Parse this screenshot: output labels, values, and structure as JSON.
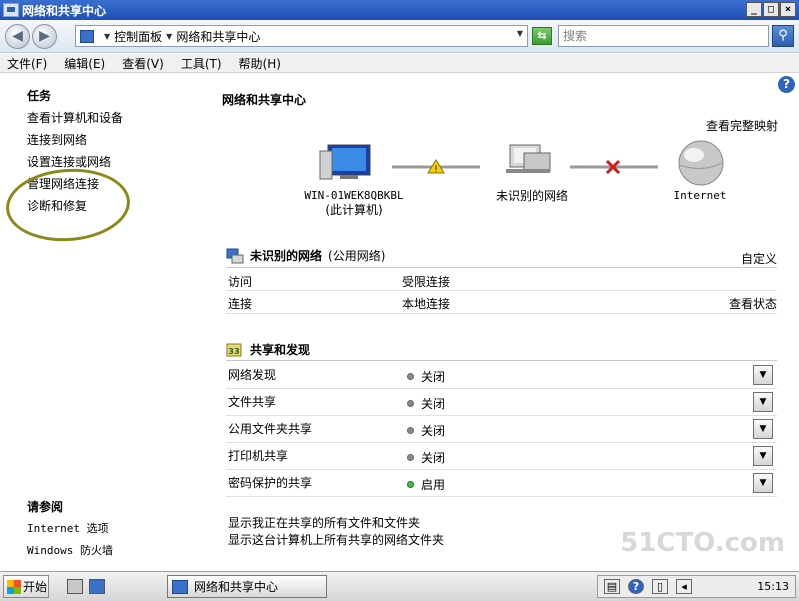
{
  "window": {
    "title": "网络和共享中心"
  },
  "win_buttons": {
    "minimize": "_",
    "maximize": "□",
    "close": "×"
  },
  "address": {
    "crumbs": [
      "控制面板",
      "网络和共享中心"
    ],
    "search_placeholder": "搜索"
  },
  "menu": [
    "文件(F)",
    "编辑(E)",
    "查看(V)",
    "工具(T)",
    "帮助(H)"
  ],
  "tasks": {
    "heading": "任务",
    "links": [
      "查看计算机和设备",
      "连接到网络",
      "设置连接或网络",
      "管理网络连接",
      "诊断和修复"
    ]
  },
  "see_also": {
    "heading": "请参阅",
    "links": [
      "Internet 选项",
      "Windows 防火墙"
    ]
  },
  "main": {
    "title": "网络和共享中心",
    "view_full_map": "查看完整映射",
    "diagram": {
      "computer_name": "WIN-01WEK8QBKBL",
      "computer_sub": "(此计算机)",
      "network_name": "未识别的网络",
      "internet": "Internet"
    },
    "network": {
      "name": "未识别的网络",
      "type": "(公用网络)",
      "customize": "自定义",
      "rows": [
        {
          "label": "访问",
          "value": "受限连接",
          "action": ""
        },
        {
          "label": "连接",
          "value": "本地连接",
          "action": "查看状态"
        }
      ]
    },
    "sharing": {
      "title": "共享和发现",
      "rows": [
        {
          "label": "网络发现",
          "value": "关闭",
          "on": false
        },
        {
          "label": "文件共享",
          "value": "关闭",
          "on": false
        },
        {
          "label": "公用文件夹共享",
          "value": "关闭",
          "on": false
        },
        {
          "label": "打印机共享",
          "value": "关闭",
          "on": false
        },
        {
          "label": "密码保护的共享",
          "value": "启用",
          "on": true
        }
      ]
    },
    "bottom_links": [
      "显示我正在共享的所有文件和文件夹",
      "显示这台计算机上所有共享的网络文件夹"
    ]
  },
  "watermark": "51CTO.com",
  "taskbar": {
    "start": "开始",
    "task_item": "网络和共享中心",
    "clock": "15:13"
  },
  "colors": {
    "titlebar": "#1e4fb8",
    "annotation": "#8a8a1a",
    "status_on": "#3fbf3f"
  }
}
